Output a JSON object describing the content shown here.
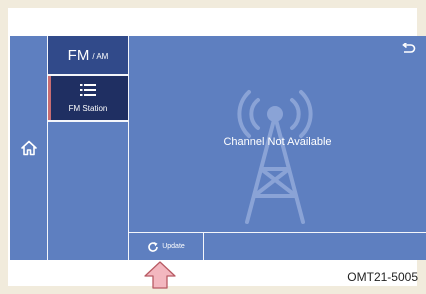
{
  "tabs": {
    "fm_label": "FM",
    "am_label": "/ AM",
    "station_label": "FM Station"
  },
  "main": {
    "message": "Channel Not Available"
  },
  "bottom_bar": {
    "update_label": "Update"
  },
  "footer": {
    "code": "OMT21-5005"
  },
  "icons": {
    "home": "home-icon",
    "list": "list-icon",
    "back": "back-icon",
    "refresh": "refresh-icon",
    "antenna": "radio-tower-icon",
    "pointer": "up-arrow-icon"
  },
  "colors": {
    "screen_bg": "#5e7fc0",
    "tab_active": "#314a8a",
    "tab_selected": "#1f2f62",
    "accent": "#c86d72",
    "pointer_fill": "#f3b7bf",
    "pointer_stroke": "#b85a63"
  }
}
